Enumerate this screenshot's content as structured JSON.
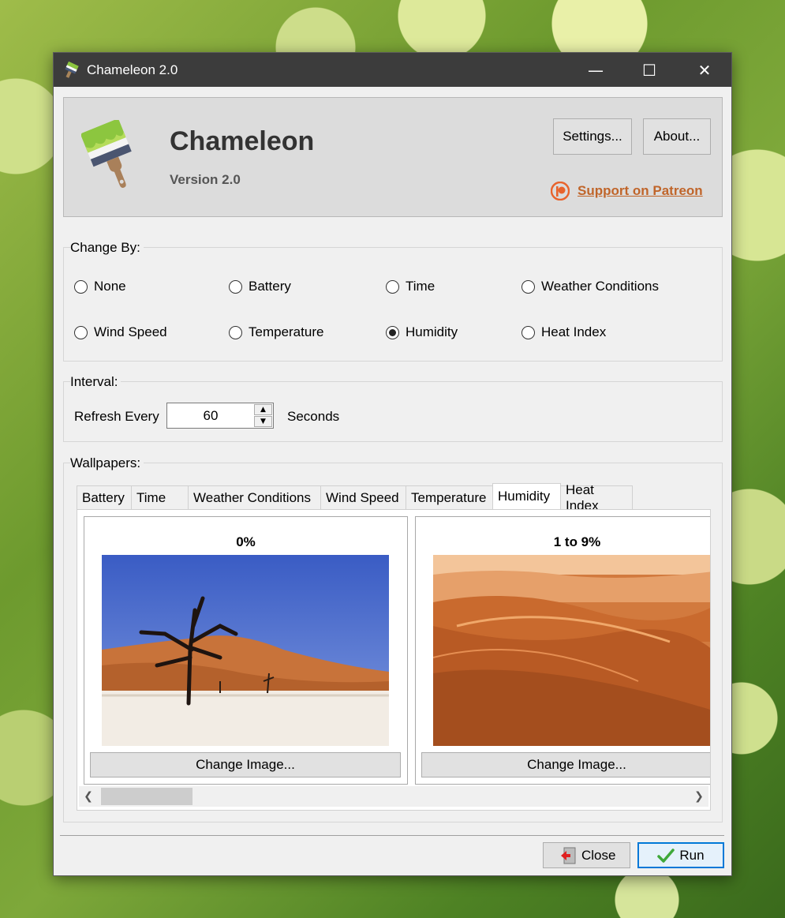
{
  "window": {
    "title": "Chameleon 2.0",
    "minimize": "—",
    "maximize": "☐",
    "close": "✕"
  },
  "header": {
    "app_name": "Chameleon",
    "version": "Version 2.0",
    "settings_label": "Settings...",
    "about_label": "About...",
    "patreon_label": "Support on Patreon"
  },
  "change_by": {
    "label": "Change By:",
    "options": [
      "None",
      "Battery",
      "Time",
      "Weather Conditions",
      "Wind Speed",
      "Temperature",
      "Humidity",
      "Heat Index"
    ],
    "selected": "Humidity"
  },
  "interval": {
    "label": "Interval:",
    "refresh_label": "Refresh Every",
    "value": "60",
    "unit": "Seconds"
  },
  "wallpapers": {
    "label": "Wallpapers:",
    "tabs": [
      "Battery",
      "Time",
      "Weather Conditions",
      "Wind Speed",
      "Temperature",
      "Humidity",
      "Heat Index"
    ],
    "active_tab": "Humidity",
    "cards": [
      {
        "label": "0%",
        "button": "Change Image..."
      },
      {
        "label": "1 to 9%",
        "button": "Change Image..."
      }
    ]
  },
  "footer": {
    "close_label": "Close",
    "run_label": "Run"
  },
  "colors": {
    "titlebar": "#3c3c3c",
    "patreon": "#c0652a",
    "accent": "#0078d7"
  }
}
